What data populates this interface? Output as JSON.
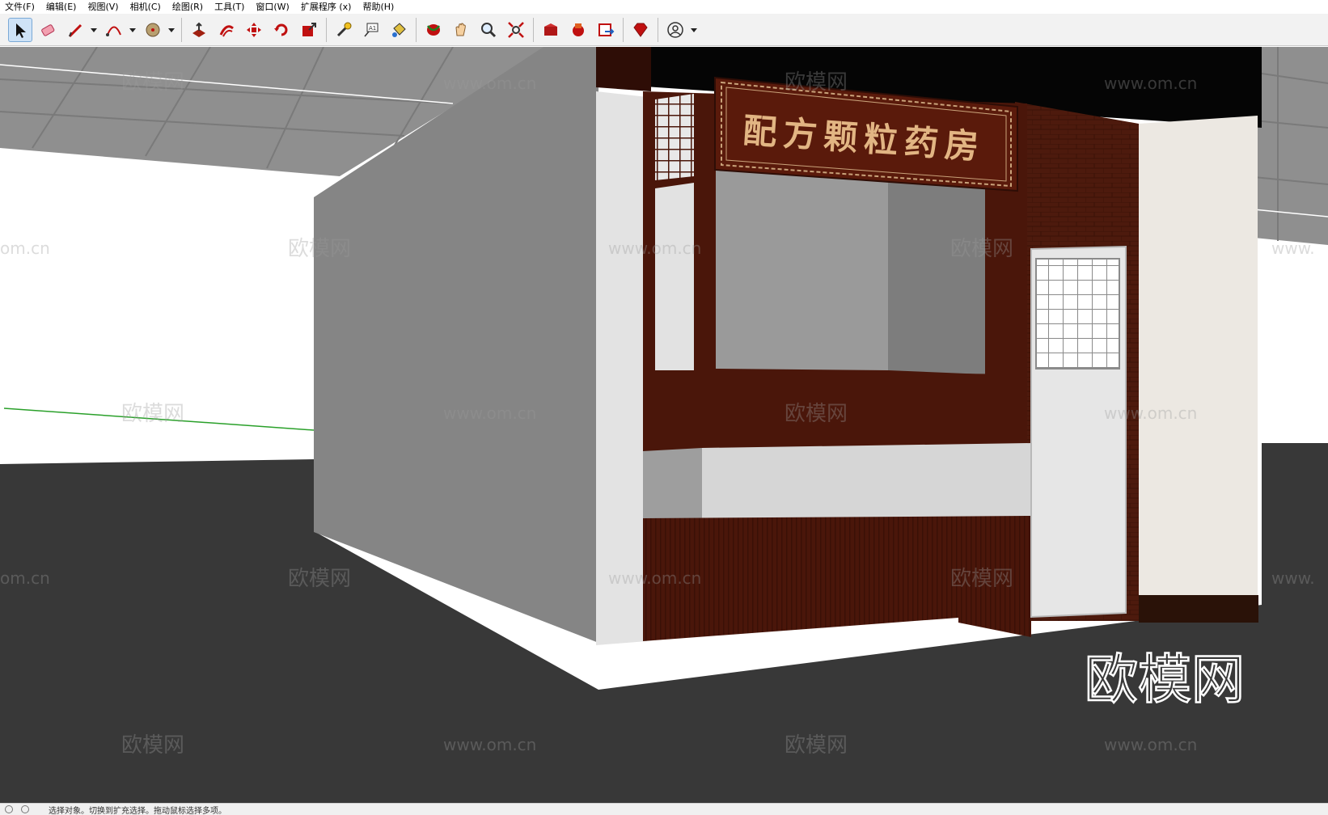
{
  "menu": [
    "文件(F)",
    "编辑(E)",
    "视图(V)",
    "相机(C)",
    "绘图(R)",
    "工具(T)",
    "窗口(W)",
    "扩展程序 (x)",
    "帮助(H)"
  ],
  "toolbar": [
    {
      "icon": "select-arrow-icon",
      "active": true
    },
    {
      "icon": "eraser-icon"
    },
    {
      "icon": "pencil-line-icon",
      "dropdown": true
    },
    {
      "icon": "arc-icon",
      "dropdown": true
    },
    {
      "icon": "shape-circle-icon",
      "dropdown": true
    },
    {
      "icon": "push-pull-icon",
      "sep_before": true
    },
    {
      "icon": "offset-icon"
    },
    {
      "icon": "move-icon"
    },
    {
      "icon": "rotate-icon"
    },
    {
      "icon": "scale-icon"
    },
    {
      "icon": "tape-measure-icon",
      "sep_before": true
    },
    {
      "icon": "text-label-icon"
    },
    {
      "icon": "paint-bucket-icon"
    },
    {
      "icon": "orbit-icon",
      "sep_before": true
    },
    {
      "icon": "pan-hand-icon"
    },
    {
      "icon": "zoom-icon"
    },
    {
      "icon": "zoom-extents-icon"
    },
    {
      "icon": "3d-warehouse-icon",
      "sep_before": true
    },
    {
      "icon": "extension-warehouse-icon"
    },
    {
      "icon": "layout-send-icon"
    },
    {
      "icon": "ruby-console-icon",
      "sep_before": true
    },
    {
      "icon": "account-user-icon",
      "sep_before": true,
      "dropdown": true
    }
  ],
  "sign": {
    "text": "配方颗粒药房"
  },
  "watermarks": {
    "brand": "欧模网",
    "url": "www.om.cn",
    "url_partial": "om.cn",
    "url_right": "www.",
    "big": "欧模网"
  },
  "status": {
    "text": "选择对象。切换到扩充选择。拖动鼠标选择多项。"
  },
  "colors": {
    "wood": "#4a160a",
    "wood_dark": "#2e0d06",
    "floor": "#383838",
    "accent": "#7aa9d6"
  }
}
